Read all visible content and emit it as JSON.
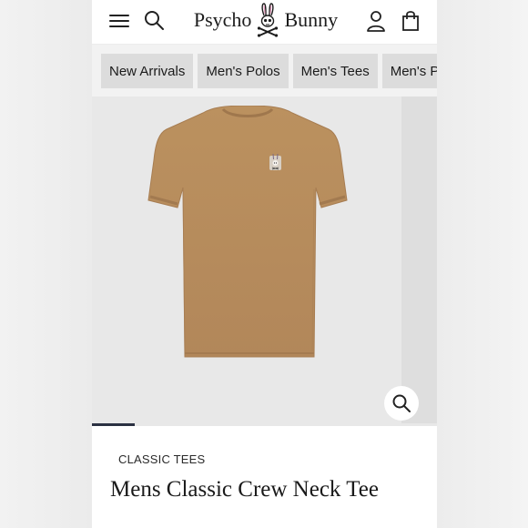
{
  "header": {
    "logo_left": "Psycho",
    "logo_right": "Bunny",
    "icons": [
      "menu-icon",
      "search-icon",
      "account-icon",
      "shopping-bag-icon"
    ]
  },
  "categories": [
    {
      "label": "New Arrivals"
    },
    {
      "label": "Men's Polos"
    },
    {
      "label": "Men's Tees"
    },
    {
      "label": "Men's Pants"
    }
  ],
  "gallery": {
    "zoom_icon": "magnifier-icon",
    "active_slide": 1
  },
  "product": {
    "collection": "CLASSIC TEES",
    "name": "Mens Classic Crew Neck Tee",
    "color": "#b58a5d"
  },
  "colors": {
    "accent": "#2b3142",
    "chip_bg": "#dcdcdc",
    "image_bg": "#e8e8e8"
  }
}
